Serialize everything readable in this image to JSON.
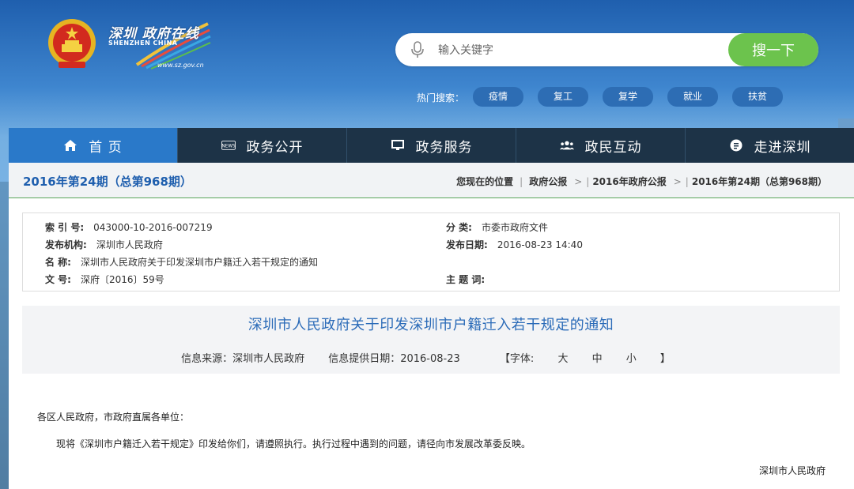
{
  "header": {
    "logo_cn": "深圳 政府在线",
    "logo_en": "SHENZHEN CHINA",
    "logo_url": "www.sz.gov.cn",
    "search_placeholder": "输入关键字",
    "search_button": "搜一下",
    "hot_label": "热门搜索：",
    "hot_tags": [
      "疫情",
      "复工",
      "复学",
      "就业",
      "扶贫"
    ]
  },
  "nav": {
    "items": [
      {
        "label": "首 页",
        "icon": "home-icon"
      },
      {
        "label": "政务公开",
        "icon": "news-icon"
      },
      {
        "label": "政务服务",
        "icon": "monitor-icon"
      },
      {
        "label": "政民互动",
        "icon": "people-icon"
      },
      {
        "label": "走进深圳",
        "icon": "info-icon"
      }
    ]
  },
  "issue_bar": {
    "issue": "2016年第24期（总第968期）",
    "crumb_label": "您现在的位置",
    "crumbs": [
      "政府公报",
      "2016年政府公报",
      "2016年第24期（总第968期）"
    ]
  },
  "meta": {
    "index_label": "索 引 号:",
    "index_value": "043000-10-2016-007219",
    "category_label": "分 类:",
    "category_value": "市委市政府文件",
    "org_label": "发布机构:",
    "org_value": "深圳市人民政府",
    "date_label": "发布日期:",
    "date_value": "2016-08-23 14:40",
    "name_label": "名 称:",
    "name_value": "深圳市人民政府关于印发深圳市户籍迁入若干规定的通知",
    "doc_label": "文 号:",
    "doc_value": "深府〔2016〕59号",
    "subject_label": "主 题 词:",
    "subject_value": ""
  },
  "article": {
    "title": "深圳市人民政府关于印发深圳市户籍迁入若干规定的通知",
    "source": "信息来源：深圳市人民政府",
    "provide_date": "信息提供日期：2016-08-23",
    "font_open": "【字体:",
    "font_large": "大",
    "font_medium": "中",
    "font_small": "小",
    "font_close": "】",
    "salutation": "各区人民政府，市政府直属各单位：",
    "paragraph": "现将《深圳市户籍迁入若干规定》印发给你们，请遵照执行。执行过程中遇到的问题，请径向市发展改革委反映。",
    "signature": "深圳市人民政府"
  },
  "colors": {
    "nav_bg": "#1d3347",
    "nav_active": "#2a79c9",
    "search_button": "#6cc34d",
    "title_blue": "#2b6bb8"
  }
}
